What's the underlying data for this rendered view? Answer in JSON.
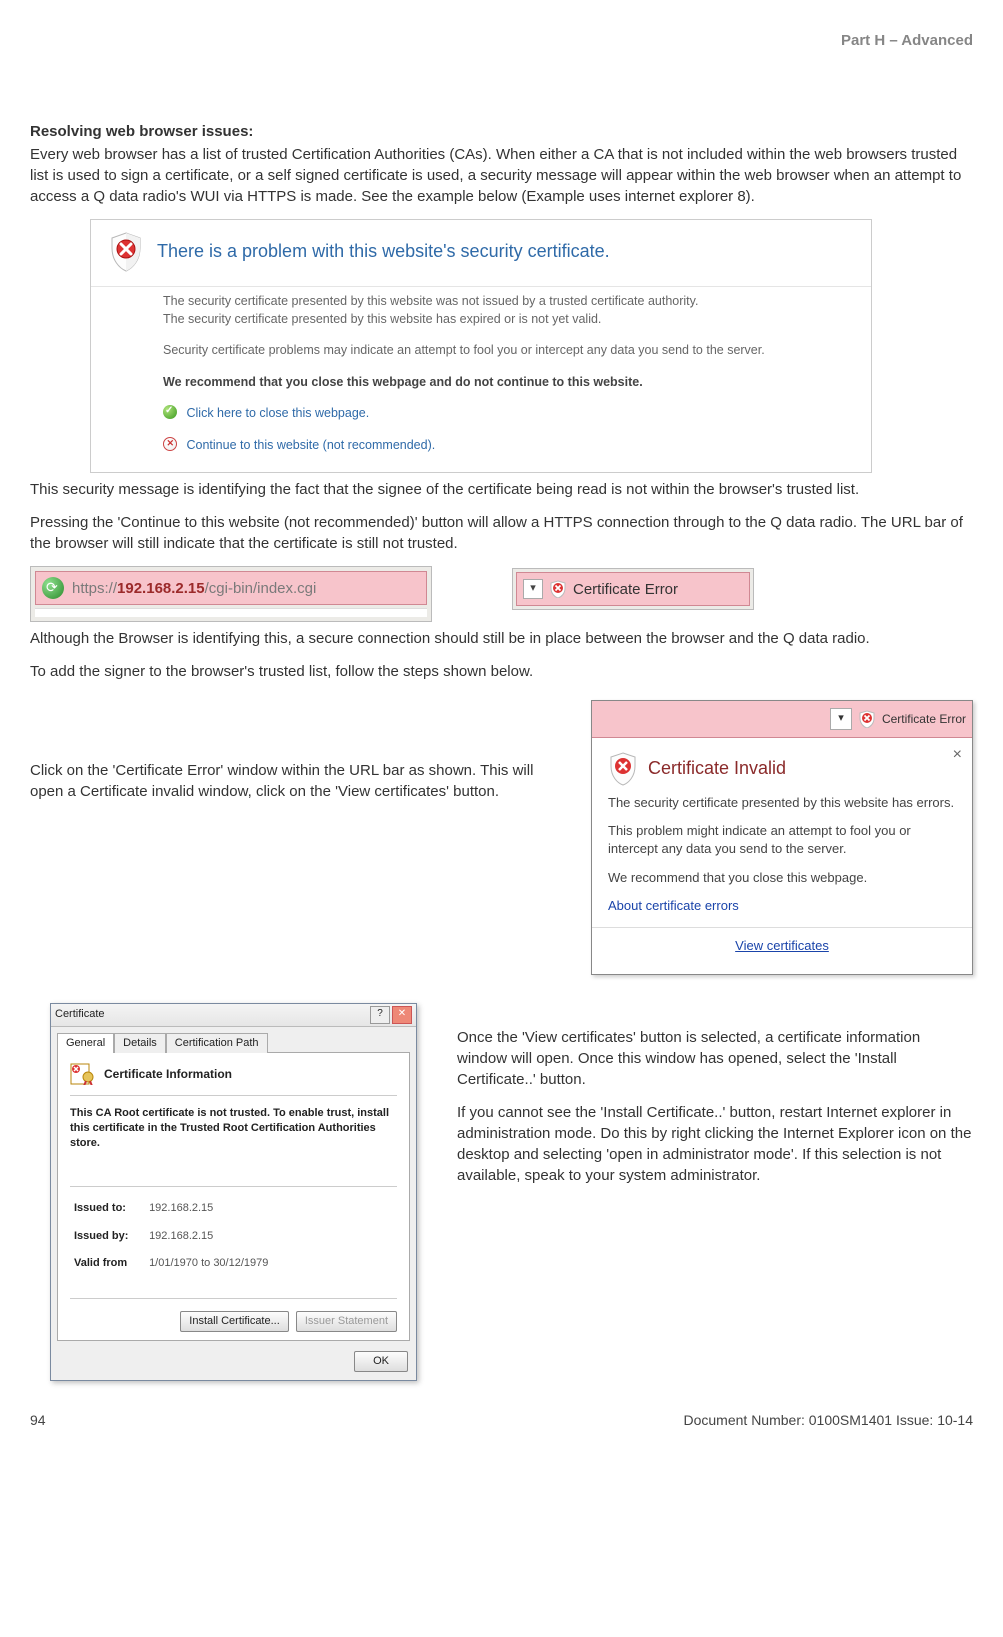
{
  "header": {
    "part": "Part H – Advanced"
  },
  "intro": {
    "title": "Resolving web browser issues:",
    "p1": "Every web browser has a list of trusted Certification Authorities (CAs). When either a CA that is not included within the web browsers trusted list is used to sign a certificate, or a self signed certificate is used, a security message will appear within the web browser when an attempt to access a Q data radio's WUI via HTTPS is made. See the example below (Example uses internet explorer 8)."
  },
  "ie_warning": {
    "title": "There is a problem with this website's security certificate.",
    "l1": "The security certificate presented by this website was not issued by a trusted certificate authority.",
    "l2": "The security certificate presented by this website has expired or is not yet valid.",
    "l3": "Security certificate problems may indicate an attempt to fool you or intercept any data you send to the server.",
    "l4": "We recommend that you close this webpage and do not continue to this website.",
    "link_close": "Click here to close this webpage.",
    "link_cont": "Continue to this website (not recommended)."
  },
  "mid": {
    "p2": "This security message is identifying the fact that the signee of the certificate being read is not within the browser's trusted list.",
    "p3": "Pressing the 'Continue to this website (not recommended)' button will allow a HTTPS connection through to the Q data radio. The URL bar of the browser will still indicate that the certificate is still not trusted."
  },
  "urlbar": {
    "scheme": "https://",
    "host": "192.168.2.15",
    "path": "/cgi-bin/index.cgi"
  },
  "certerr_label": "Certificate Error",
  "after_bars": {
    "p4": "Although the Browser is identifying this, a secure connection should still be in place between the browser and the Q data radio.",
    "p5": "To add the signer to the browser's trusted list, follow the steps shown below."
  },
  "step_left": "Click on the 'Certificate Error' window within the URL bar as shown. This will open a Certificate invalid window, click on the 'View certificates' button.",
  "popup": {
    "bar_label": "Certificate Error",
    "title": "Certificate Invalid",
    "p1": "The security certificate presented by this website has errors.",
    "p2": "This problem might indicate an attempt to fool you or intercept any data you send to the server.",
    "p3": "We recommend that you close this webpage.",
    "about": "About certificate errors",
    "view": "View certificates"
  },
  "cert_dialog": {
    "title": "Certificate",
    "tabs": [
      "General",
      "Details",
      "Certification Path"
    ],
    "heading": "Certificate Information",
    "msg": "This CA Root certificate is not trusted. To enable trust, install this certificate in the Trusted Root Certification Authorities store.",
    "issued_to_label": "Issued to:",
    "issued_to": "192.168.2.15",
    "issued_by_label": "Issued by:",
    "issued_by": "192.168.2.15",
    "valid_label": "Valid from",
    "valid_from": "1/01/1970",
    "valid_to_word": "to",
    "valid_to": "30/12/1979",
    "btn_install": "Install Certificate...",
    "btn_issuer": "Issuer Statement",
    "btn_ok": "OK"
  },
  "right_low": {
    "p1": "Once the 'View certificates' button is selected, a certificate information window will open. Once this window has opened, select the 'Install Certificate..' button.",
    "p2": "If you cannot see the 'Install Certificate..' button, restart Internet explorer in administration mode. Do this by right clicking the Internet Explorer icon on the desktop and selecting 'open in administrator mode'. If this selection is not available, speak to your system administrator."
  },
  "footer": {
    "page": "94",
    "doc": "Document Number: 0100SM1401   Issue: 10-14"
  }
}
